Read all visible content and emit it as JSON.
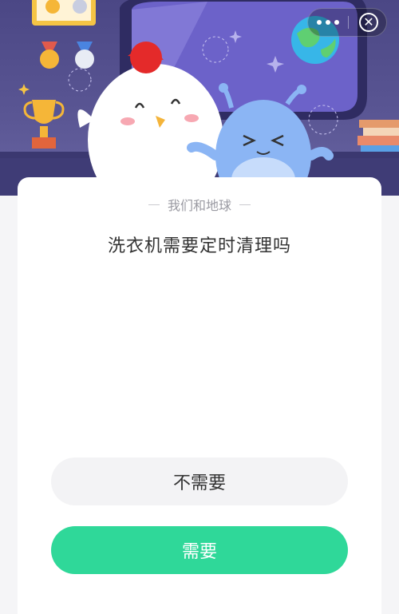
{
  "window": {
    "more_icon": "more-dots-icon",
    "close_icon": "close-circle-icon",
    "close_glyph": "✕"
  },
  "card": {
    "subtitle": "我们和地球",
    "question": "洗衣机需要定时清理吗"
  },
  "options": [
    {
      "label": "不需要"
    },
    {
      "label": "需要"
    }
  ],
  "colors": {
    "banner": "#4b4785",
    "accent": "#2fd899",
    "option_bg": "#f3f3f5",
    "page_bg": "#f5f5f7"
  }
}
